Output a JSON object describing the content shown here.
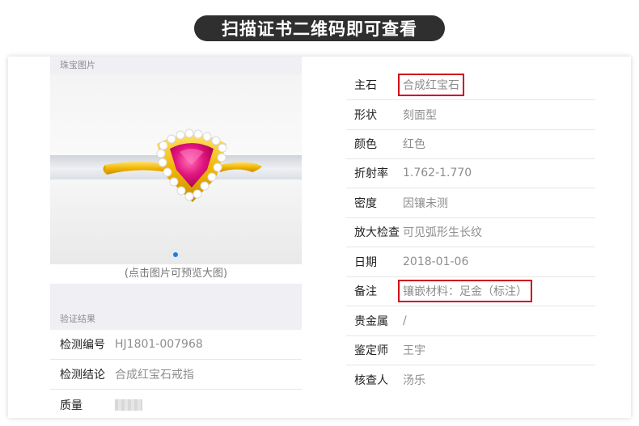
{
  "banner": {
    "title": "扫描证书二维码即可查看"
  },
  "left": {
    "photo_header": "珠宝图片",
    "photo_caption": "(点击图片可预览大图)",
    "verify_header": "验证结果",
    "rows": [
      {
        "label": "检测编号",
        "value": "HJ1801-007968"
      },
      {
        "label": "检测结论",
        "value": "合成红宝石戒指"
      },
      {
        "label": "质量",
        "value": ""
      }
    ]
  },
  "right": {
    "rows": [
      {
        "label": "主石",
        "value": "合成红宝石",
        "highlighted": true
      },
      {
        "label": "形状",
        "value": "刻面型"
      },
      {
        "label": "颜色",
        "value": "红色"
      },
      {
        "label": "折射率",
        "value": "1.762-1.770"
      },
      {
        "label": "密度",
        "value": "因镶未测"
      },
      {
        "label": "放大检查",
        "value": "可见弧形生长纹"
      },
      {
        "label": "日期",
        "value": "2018-01-06"
      },
      {
        "label": "备注",
        "value": "镶嵌材料：足金（标注）",
        "highlighted": true
      },
      {
        "label": "贵金属",
        "value": "/"
      },
      {
        "label": "鉴定师",
        "value": "王宇"
      },
      {
        "label": "核查人",
        "value": "汤乐"
      }
    ]
  },
  "colors": {
    "highlight_border": "#d0021b",
    "carousel_dot": "#1a7cf1",
    "banner_bg": "#2f2f2f"
  },
  "icons": {
    "photo": "gold-ruby-ring-photo"
  }
}
